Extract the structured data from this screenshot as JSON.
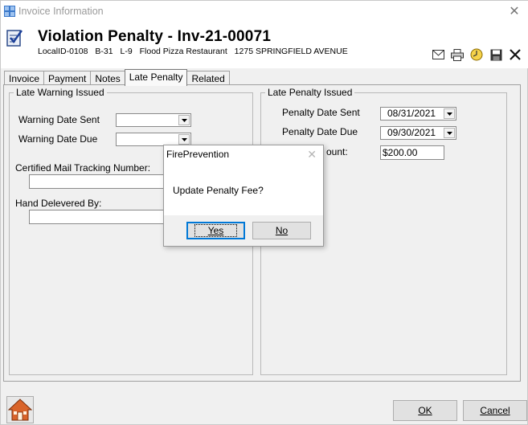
{
  "window": {
    "title": "Invoice Information",
    "close_glyph": "✕"
  },
  "header": {
    "title": "Violation Penalty - Inv-21-00071",
    "local_id": "LocalID-0108",
    "block": "B-31",
    "lot": "L-9",
    "business": "Flood Pizza Restaurant",
    "address": "1275 SPRINGFIELD AVENUE"
  },
  "toolbar": {
    "icons": [
      "email-icon",
      "print-icon",
      "clock-icon",
      "save-icon",
      "delete-icon"
    ]
  },
  "tabs": [
    {
      "label": "Invoice",
      "active": false
    },
    {
      "label": "Payment",
      "active": false
    },
    {
      "label": "Notes",
      "active": false
    },
    {
      "label": "Late Penalty",
      "active": true
    },
    {
      "label": "Related",
      "active": false
    }
  ],
  "late_warning": {
    "legend": "Late Warning Issued",
    "warning_date_sent_label": "Warning Date Sent",
    "warning_date_sent": "",
    "warning_date_due_label": "Warning Date Due",
    "warning_date_due": "",
    "certified_mail_label": "Certified Mail Tracking Number:",
    "certified_mail_value": "",
    "hand_delivered_label": "Hand Delevered By:",
    "hand_delivered_value": ""
  },
  "late_penalty": {
    "legend": "Late Penalty Issued",
    "penalty_date_sent_label": "Penalty Date Sent",
    "penalty_date_sent": "08/31/2021",
    "penalty_date_due_label": "Penalty Date Due",
    "penalty_date_due": "09/30/2021",
    "penalty_amount_label": "ount:",
    "penalty_amount": "$200.00"
  },
  "footer": {
    "ok_label": "OK",
    "cancel_label": "Cancel"
  },
  "dialog": {
    "title": "FirePrevention",
    "message": "Update Penalty Fee?",
    "yes_label": "Yes",
    "no_label": "No"
  },
  "colors": {
    "accent_blue": "#0078d7",
    "title_gray": "#9a9a9a"
  }
}
